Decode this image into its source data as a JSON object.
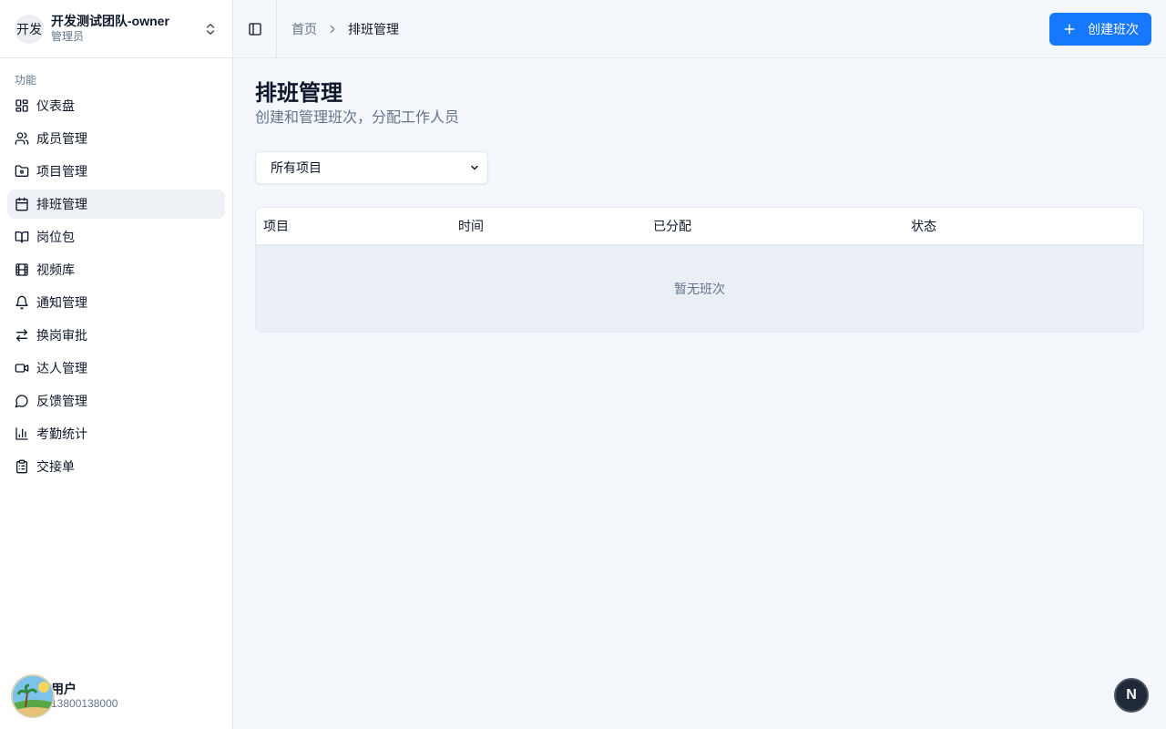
{
  "team": {
    "avatar_text": "开发",
    "name": "开发测试团队-owner",
    "role": "管理员"
  },
  "sidebar": {
    "section_label": "功能",
    "items": [
      {
        "label": "仪表盘",
        "icon": "dashboard-icon"
      },
      {
        "label": "成员管理",
        "icon": "users-icon"
      },
      {
        "label": "项目管理",
        "icon": "folder-icon"
      },
      {
        "label": "排班管理",
        "icon": "calendar-icon",
        "active": true
      },
      {
        "label": "岗位包",
        "icon": "book-icon"
      },
      {
        "label": "视频库",
        "icon": "film-icon"
      },
      {
        "label": "通知管理",
        "icon": "bell-icon"
      },
      {
        "label": "换岗审批",
        "icon": "swap-icon"
      },
      {
        "label": "达人管理",
        "icon": "video-icon"
      },
      {
        "label": "反馈管理",
        "icon": "message-icon"
      },
      {
        "label": "考勤统计",
        "icon": "bar-chart-icon"
      },
      {
        "label": "交接单",
        "icon": "clipboard-icon"
      }
    ]
  },
  "user": {
    "name": "用户",
    "phone": "13800138000"
  },
  "header": {
    "breadcrumb_home": "首页",
    "breadcrumb_current": "排班管理",
    "create_button": "创建班次"
  },
  "main": {
    "title": "排班管理",
    "subtitle": "创建和管理班次，分配工作人员",
    "filter_value": "所有项目",
    "table": {
      "columns": [
        "项目",
        "时间",
        "已分配",
        "状态"
      ],
      "empty_text": "暂无班次"
    }
  },
  "fab_label": "N",
  "colors": {
    "accent": "#1677ff",
    "active_nav_bg": "#eef1f6",
    "empty_row_bg": "#eaeef5"
  }
}
